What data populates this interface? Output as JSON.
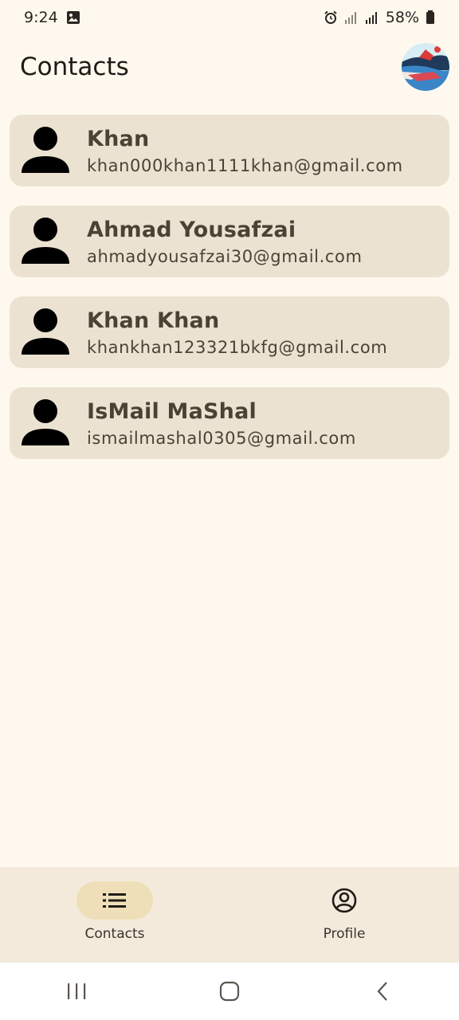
{
  "status_bar": {
    "time": "9:24",
    "battery": "58%",
    "icons": [
      "gallery-notification-icon",
      "alarm-icon",
      "signal-icon",
      "signal-icon",
      "battery-icon"
    ]
  },
  "header": {
    "title": "Contacts",
    "avatar_icon": "profile-avatar-image"
  },
  "contacts": [
    {
      "name": "Khan",
      "email": "khan000khan1111khan@gmail.com"
    },
    {
      "name": "Ahmad Yousafzai",
      "email": "ahmadyousafzai30@gmail.com"
    },
    {
      "name": "Khan Khan",
      "email": "khankhan123321bkfg@gmail.com"
    },
    {
      "name": "IsMail MaShal",
      "email": "ismailmashal0305@gmail.com"
    }
  ],
  "bottom_nav": {
    "items": [
      {
        "label": "Contacts",
        "icon": "list-icon",
        "selected": true
      },
      {
        "label": "Profile",
        "icon": "account-circle-icon",
        "selected": false
      }
    ]
  },
  "system_nav": {
    "icons": [
      "recents-icon",
      "home-icon",
      "back-icon"
    ]
  },
  "colors": {
    "background": "#FFF8EE",
    "card": "#EBE2D1",
    "nav_bar": "#F3EADB",
    "nav_active_pill": "#EEDFB8",
    "text_primary": "#4A4234"
  }
}
